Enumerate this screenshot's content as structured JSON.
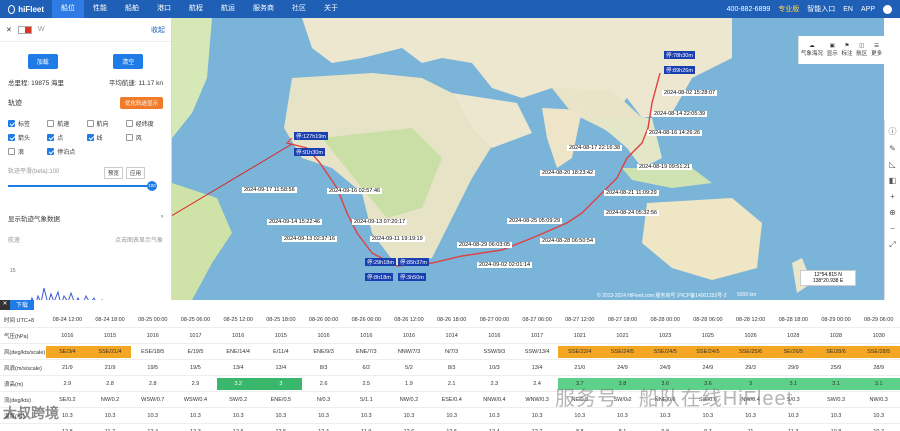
{
  "nav": {
    "logo": "hiFleet",
    "items": [
      "船位",
      "性能",
      "船舶",
      "港口",
      "航程",
      "航运",
      "服务商",
      "社区",
      "关于"
    ],
    "right": [
      "400-882-6899",
      "专业版",
      "智能入口",
      "EN",
      "APP"
    ]
  },
  "panel": {
    "ship_label": "W",
    "collapse": "收起",
    "btn_a": "加载",
    "btn_b": "清空",
    "total_range": "总里程: 19875 海里",
    "avg_speed": "平均航速: 11.17 kn",
    "track_label": "轨迹",
    "track_btn": "优化轨迹显示",
    "checks": [
      {
        "label": "标签",
        "on": true
      },
      {
        "label": "航速",
        "on": false
      },
      {
        "label": "航向",
        "on": false
      },
      {
        "label": "经纬度",
        "on": false
      },
      {
        "label": "箭头",
        "on": true
      },
      {
        "label": "点",
        "on": true
      },
      {
        "label": "线",
        "on": true
      },
      {
        "label": "风",
        "on": false
      },
      {
        "label": "浪",
        "on": false
      },
      {
        "label": "停泊点",
        "on": true
      }
    ],
    "smooth_label": "轨迹平滑(beta):100",
    "slider_btns": [
      "预览",
      "应用"
    ],
    "slider_value": "100",
    "show_wx": "显示轨迹气象数据",
    "fc_label": "航速",
    "fc_right": "点击图表显示气象",
    "y_tick": "15"
  },
  "map": {
    "tools": [
      "气象海况",
      "显示",
      "标注",
      "航区",
      "更多"
    ],
    "labels": [
      "2024-08-02 15:28:07",
      "2024-08-14 22:05:39",
      "2024-08-16 14:26:26",
      "2024-08-17 22:16:38",
      "2024-08-19 09:51:21",
      "2024-08-20 18:23:42",
      "2024-08-21 11:09:29",
      "2024-08-24 05:32:56",
      "2024-08-25 05:09:29",
      "2024-08-28 06:50:54",
      "2024-08-29 06:03:05",
      "2024-09-02 02:01:14",
      "2024-09-11 19:19:19",
      "2024-09-13 02:37:16",
      "2024-09-13 07:20:17",
      "2024-09-14 15:22:46",
      "2024-09-16 02:57:46",
      "2024-09-17 11:58:56"
    ],
    "stops": [
      "停:78h30m",
      "停:89h26m",
      "停:127h19m",
      "停:91h30m",
      "停:29h18m",
      "停:85h37m",
      "停:8h18m",
      "停:3h50m"
    ],
    "copyright": "© 2013-2024 HiFleet.com 服务商号 沪ICP备14001153号-2",
    "coord": "12°54.815 N 138°20.938 E",
    "scale": "5000 km"
  },
  "forecast": {
    "tab": "下载",
    "times": [
      "08-24 12:00",
      "08-24 18:00",
      "08-25 00:00",
      "08-25 06:00",
      "08-25 12:00",
      "08-25 18:00",
      "08-26 00:00",
      "08-26 06:00",
      "08-26 12:00",
      "08-26 18:00",
      "08-27 00:00",
      "08-27 06:00",
      "08-27 12:00",
      "08-27 18:00",
      "08-28 00:00",
      "08-28 06:00",
      "08-28 12:00",
      "08-28 18:00",
      "08-29 00:00",
      "08-29 06:00"
    ],
    "rows": [
      {
        "label": "气压(hPa)",
        "cells": [
          "1016",
          "1015",
          "1016",
          "1017",
          "1016",
          "1015",
          "1016",
          "1016",
          "1016",
          "1014",
          "1016",
          "1017",
          "1021",
          "1021",
          "1023",
          "1025",
          "1026",
          "1028",
          "1028",
          "1030"
        ]
      },
      {
        "label": "风(deg/kts/scale)",
        "cells": [
          "SE/3/4",
          "SSE/21/4",
          "ESE/18/5",
          "E/19/5",
          "ENE/14/4",
          "E/11/4",
          "ENE/9/3",
          "ENE/7/3",
          "NNW/7/3",
          "N/7/3",
          "SSW/9/3",
          "SSW/13/4",
          "SSE/22/4",
          "SSE/24/5",
          "SSE/24/5",
          "SSE/24/5",
          "SSE/25/6",
          "SE/26/5",
          "SE/28/6",
          "SSE/28/5"
        ]
      },
      {
        "label": "风浪(m/s/scale)",
        "cells": [
          "21/9",
          "21/9",
          "19/5",
          "19/5",
          "13/4",
          "13/4",
          "8/3",
          "6/2",
          "5/2",
          "8/3",
          "10/3",
          "13/4",
          "21/0",
          "24/9",
          "24/9",
          "24/9",
          "29/3",
          "29/9",
          "25/9",
          "28/9"
        ]
      },
      {
        "label": "浪高(m)",
        "cells": [
          "2.9",
          "2.8",
          "2.8",
          "2.9",
          "3.2",
          "3",
          "2.6",
          "2.5",
          "1.9",
          "2.1",
          "2.3",
          "2.4",
          "3.7",
          "3.8",
          "3.6",
          "3.6",
          "3",
          "3.1",
          "3.1",
          "3.1"
        ]
      },
      {
        "label": "流(deg/kts)",
        "cells": [
          "SE/0.2",
          "NW/0.2",
          "WSW/0.7",
          "WSW/0.4",
          "SW/0.2",
          "ENE/0.5",
          "N/0.3",
          "S/1.1",
          "NW/0.2",
          "ESE/0.4",
          "NNW/0.4",
          "WNW/0.3",
          "NE/0.3",
          "SW/0.2",
          "NNE/0.6",
          "SW/0.6",
          "NW/0.4",
          "S/0.3",
          "SW/0.3",
          "NW/0.3"
        ]
      },
      {
        "label": "温度(°C)",
        "cells": [
          "10.3",
          "10.3",
          "10.3",
          "10.3",
          "10.3",
          "10.3",
          "10.3",
          "10.3",
          "10.3",
          "10.3",
          "10.3",
          "10.3",
          "10.3",
          "10.3",
          "10.3",
          "10.3",
          "10.3",
          "10.3",
          "10.3",
          "10.3"
        ]
      },
      {
        "label": "",
        "cells": [
          "12.8",
          "11.7",
          "12.4",
          "12.3",
          "12.6",
          "12.5",
          "12.4",
          "11.9",
          "12.6",
          "12.5",
          "12.4",
          "12.2",
          "8.8",
          "8.1",
          "9.8",
          "9.7",
          "11",
          "11.3",
          "10.8",
          "10.7"
        ]
      }
    ],
    "time_header": "时间 UTC+8"
  },
  "watermark": "服务号 · 船队在线HiFleet",
  "watermark2": "大叔跨境"
}
